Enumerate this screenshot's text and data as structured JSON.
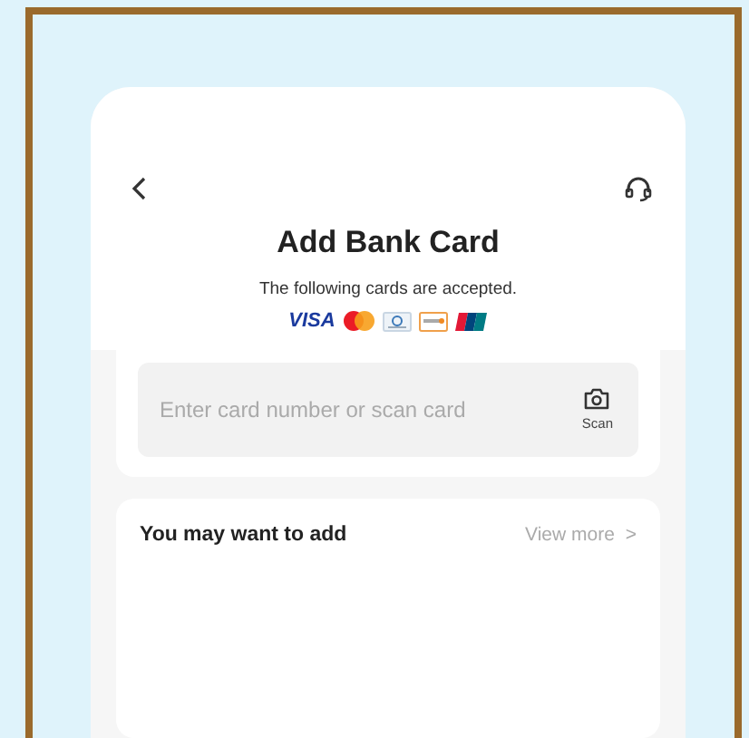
{
  "header": {
    "title": "Add Bank Card",
    "subtitle": "The following cards are accepted."
  },
  "accepted_cards": [
    {
      "kind": "visa",
      "label": "VISA"
    },
    {
      "kind": "mastercard"
    },
    {
      "kind": "diners"
    },
    {
      "kind": "discover"
    },
    {
      "kind": "unionpay"
    }
  ],
  "card_field": {
    "placeholder": "Enter card number or scan card",
    "scan_label": "Scan"
  },
  "suggestions": {
    "title": "You may want to add",
    "link": "View more",
    "link_icon": ">"
  }
}
